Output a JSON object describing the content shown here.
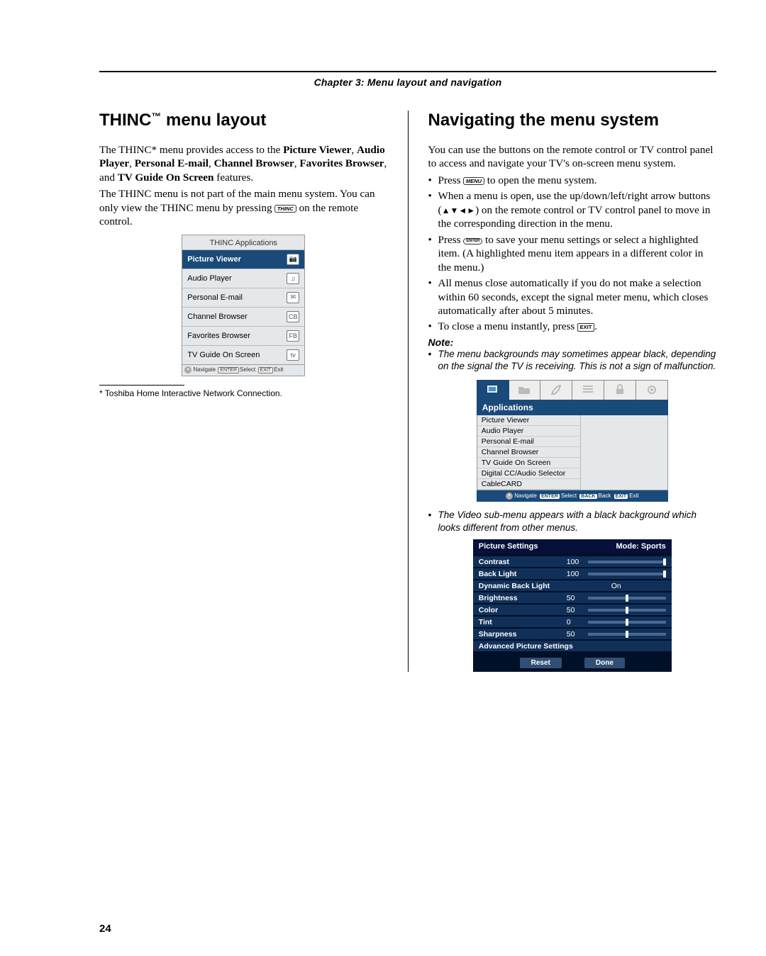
{
  "header": {
    "chapter": "Chapter 3: Menu layout and navigation"
  },
  "left": {
    "heading_pre": "THINC",
    "heading_tm": "™",
    "heading_post": " menu layout",
    "p1_a": "The THINC* menu provides access to the ",
    "p1_b": "Picture Viewer",
    "p1_c": ", ",
    "p1_d": "Audio Player",
    "p1_e": ", ",
    "p1_f": "Personal E-mail",
    "p1_g": ", ",
    "p1_h": "Channel Browser",
    "p1_i": ", ",
    "p1_j": "Favorites Browser",
    "p1_k": ", and ",
    "p1_l": "TV Guide On Screen",
    "p1_m": " features.",
    "p2_a": "The THINC menu is not part of the main menu system. You can only view the THINC menu by pressing ",
    "p2_key": "THINC",
    "p2_b": " on the remote control.",
    "footnote": "*  Toshiba Home Interactive Network Connection.",
    "menu": {
      "title": "THINC Applications",
      "rows": [
        {
          "label": "Picture Viewer",
          "icon": "camera"
        },
        {
          "label": "Audio Player",
          "icon": "note"
        },
        {
          "label": "Personal E-mail",
          "icon": "mail"
        },
        {
          "label": "Channel Browser",
          "icon": "cb"
        },
        {
          "label": "Favorites Browser",
          "icon": "fb"
        },
        {
          "label": "TV Guide On Screen",
          "icon": "tv"
        }
      ],
      "footer": {
        "nav": "Navigate",
        "sel_key": "ENTER",
        "sel": "Select",
        "exit_key": "EXIT",
        "exit": "Exit"
      }
    }
  },
  "right": {
    "heading": "Navigating the menu system",
    "intro": "You can use the buttons on the remote control or TV control panel to access and navigate your TV's on-screen menu system.",
    "b1_a": "Press ",
    "b1_key": "MENU",
    "b1_b": " to open the menu system.",
    "b2_a": "When a menu is open, use the up/down/left/right arrow buttons (",
    "b2_arrows": "▲▼◄►",
    "b2_b": ") on the remote control or TV control panel to move in the corresponding direction in the menu.",
    "b3_a": "Press ",
    "b3_key": "ENTER",
    "b3_b": " to save your menu settings or select a highlighted item. (A highlighted menu item appears in a different color in the menu.)",
    "b4": "All menus close automatically if you do not make a selection within 60 seconds, except the signal meter menu, which closes automatically after about 5 minutes.",
    "b5_a": "To close a menu instantly, press ",
    "b5_key": "EXIT",
    "b5_b": ".",
    "note_heading": "Note:",
    "note1": "The menu backgrounds may sometimes appear black, depending on the signal the TV is receiving. This is not a sign of malfunction.",
    "note2": "The Video sub-menu appears with a black background which looks different from other menus.",
    "apps_menu": {
      "title": "Applications",
      "rows": [
        "Picture Viewer",
        "Audio Player",
        "Personal E-mail",
        "Channel Browser",
        "TV Guide On Screen",
        "Digital CC/Audio Selector",
        "CableCARD"
      ],
      "footer": {
        "nav": "Navigate",
        "sel_key": "ENTER",
        "sel": "Select",
        "back_key": "BACK",
        "back": "Back",
        "exit_key": "EXIT",
        "exit": "Exit"
      }
    },
    "pic_menu": {
      "title": "Picture Settings",
      "mode": "Mode: Sports",
      "rows": [
        {
          "label": "Contrast",
          "val": "100",
          "pct": 100
        },
        {
          "label": "Back Light",
          "val": "100",
          "pct": 100
        },
        {
          "label": "Dynamic Back Light",
          "text": "On"
        },
        {
          "label": "Brightness",
          "val": "50",
          "pct": 50
        },
        {
          "label": "Color",
          "val": "50",
          "pct": 50
        },
        {
          "label": "Tint",
          "val": "0",
          "pct": 50
        },
        {
          "label": "Sharpness",
          "val": "50",
          "pct": 50
        },
        {
          "label": "Advanced Picture Settings"
        }
      ],
      "reset": "Reset",
      "done": "Done"
    }
  },
  "page_number": "24"
}
